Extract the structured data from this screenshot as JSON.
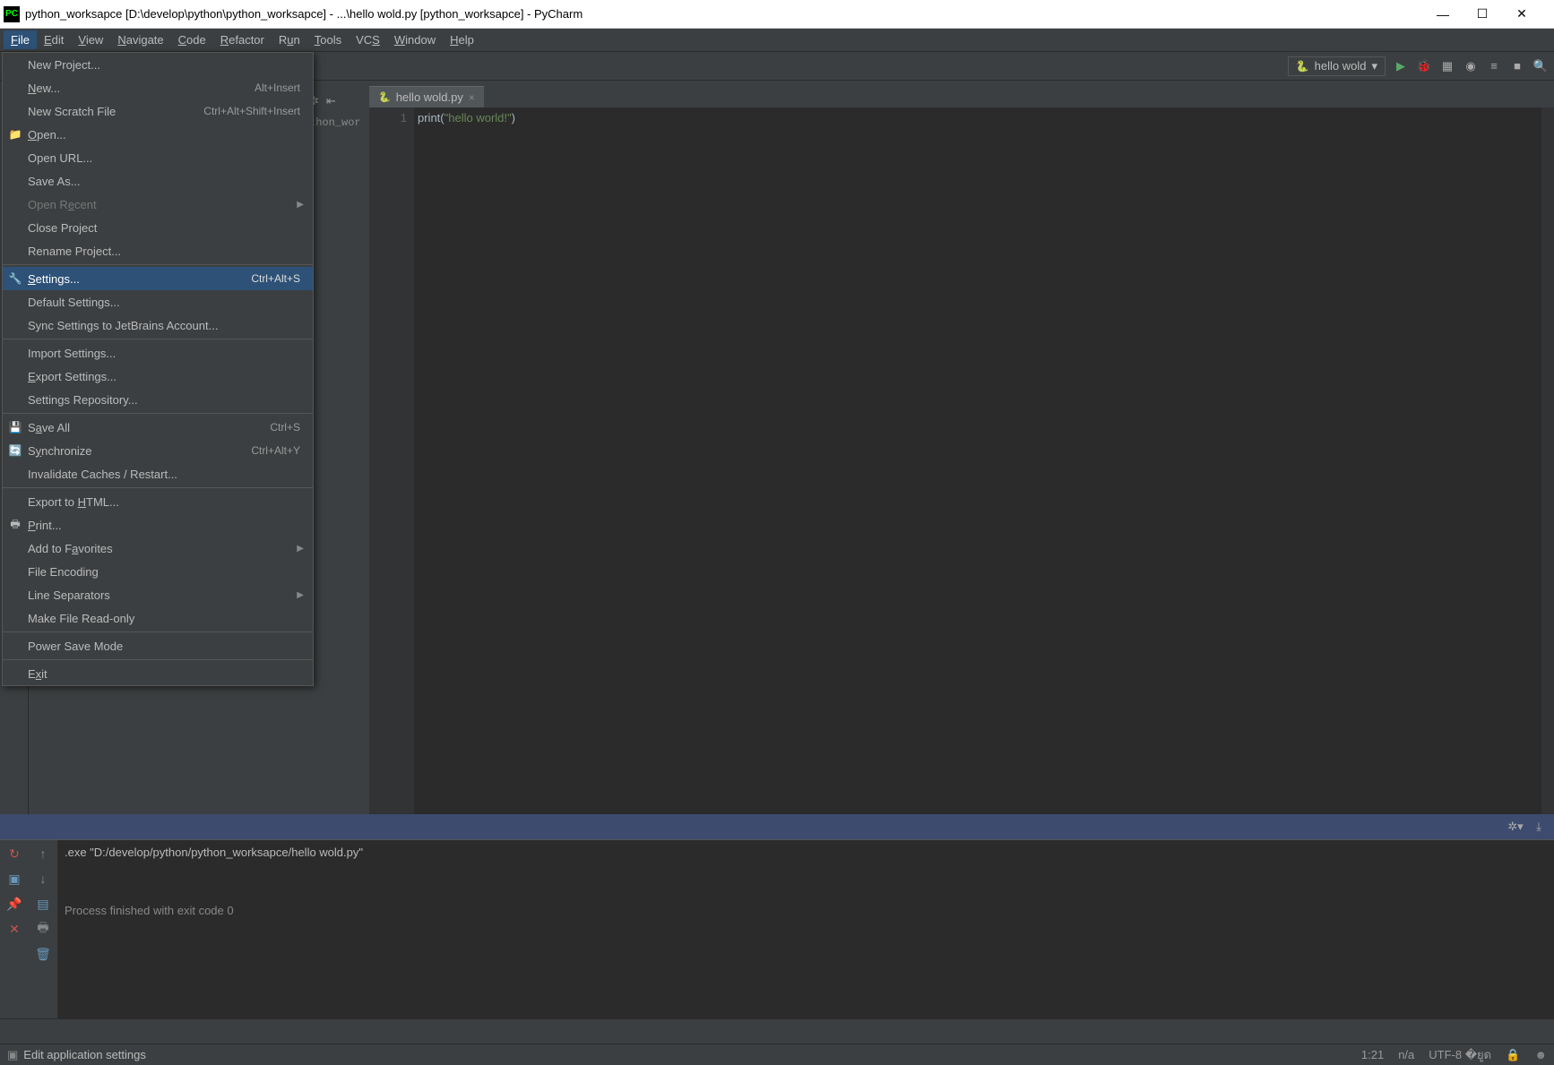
{
  "window": {
    "title": "python_worksapce [D:\\develop\\python\\python_worksapce] - ...\\hello wold.py [python_worksapce] - PyCharm",
    "minimize": "—",
    "maximize": "☐",
    "close": "✕"
  },
  "menubar": {
    "file": "File",
    "edit": "Edit",
    "view": "View",
    "navigate": "Navigate",
    "code": "Code",
    "refactor": "Refactor",
    "run": "Run",
    "tools": "Tools",
    "vcs": "VCS",
    "window": "Window",
    "help": "Help"
  },
  "file_menu": {
    "items": [
      {
        "label": "New Project...",
        "shortcut": "",
        "icon": "",
        "disabled": false
      },
      {
        "label_html": "<u>N</u>ew...",
        "shortcut": "Alt+Insert",
        "icon": "",
        "disabled": false
      },
      {
        "label": "New Scratch File",
        "shortcut": "Ctrl+Alt+Shift+Insert",
        "icon": "",
        "disabled": false
      },
      {
        "label_html": "<u>O</u>pen...",
        "shortcut": "",
        "icon": "folder",
        "disabled": false
      },
      {
        "label": "Open URL...",
        "shortcut": "",
        "icon": "",
        "disabled": false
      },
      {
        "label": "Save As...",
        "shortcut": "",
        "icon": "",
        "disabled": false
      },
      {
        "label_html": "Open R<u>e</u>cent",
        "shortcut": "",
        "icon": "",
        "disabled": true,
        "submenu": true
      },
      {
        "label": "Close Project",
        "shortcut": "",
        "icon": "",
        "disabled": false
      },
      {
        "label": "Rename Project...",
        "shortcut": "",
        "icon": "",
        "disabled": false
      },
      {
        "sep": true
      },
      {
        "label_html": "<u>S</u>ettings...",
        "shortcut": "Ctrl+Alt+S",
        "icon": "gear",
        "disabled": false,
        "selected": true
      },
      {
        "label": "Default Settings...",
        "shortcut": "",
        "icon": "",
        "disabled": false
      },
      {
        "label": "Sync Settings to JetBrains Account...",
        "shortcut": "",
        "icon": "",
        "disabled": false
      },
      {
        "sep": true
      },
      {
        "label": "Import Settings...",
        "shortcut": "",
        "icon": "",
        "disabled": false
      },
      {
        "label_html": "<u>E</u>xport Settings...",
        "shortcut": "",
        "icon": "",
        "disabled": false
      },
      {
        "label": "Settings Repository...",
        "shortcut": "",
        "icon": "",
        "disabled": false
      },
      {
        "sep": true
      },
      {
        "label_html": "S<u>a</u>ve All",
        "shortcut": "Ctrl+S",
        "icon": "save",
        "disabled": false
      },
      {
        "label_html": "S<u>y</u>nchronize",
        "shortcut": "Ctrl+Alt+Y",
        "icon": "sync",
        "disabled": false
      },
      {
        "label": "Invalidate Caches / Restart...",
        "shortcut": "",
        "icon": "",
        "disabled": false
      },
      {
        "sep": true
      },
      {
        "label_html": "Export to <u>H</u>TML...",
        "shortcut": "",
        "icon": "",
        "disabled": false
      },
      {
        "label_html": "<u>P</u>rint...",
        "shortcut": "",
        "icon": "print",
        "disabled": false
      },
      {
        "label_html": "Add to F<u>a</u>vorites",
        "shortcut": "",
        "icon": "",
        "disabled": false,
        "submenu": true
      },
      {
        "label": "File Encoding",
        "shortcut": "",
        "icon": "",
        "disabled": false
      },
      {
        "label": "Line Separators",
        "shortcut": "",
        "icon": "",
        "disabled": false,
        "submenu": true
      },
      {
        "label": "Make File Read-only",
        "shortcut": "",
        "icon": "",
        "disabled": false
      },
      {
        "sep": true
      },
      {
        "label": "Power Save Mode",
        "shortcut": "",
        "icon": "",
        "disabled": false
      },
      {
        "sep": true
      },
      {
        "label_html": "E<u>x</u>it",
        "shortcut": "",
        "icon": "",
        "disabled": false
      }
    ]
  },
  "toolbar": {
    "run_config": "hello wold",
    "dropdown_arrow": "▾"
  },
  "editor": {
    "tab_name": "hello wold.py",
    "line_number": "1",
    "code_fn": "print",
    "code_paren_open": "(",
    "code_str": "\"hello world!\"",
    "code_paren_close": ")"
  },
  "proj_peek": "thon_wor",
  "run_panel": {
    "output_line1": ".exe \"D:/develop/python/python_worksapce/hello wold.py\"",
    "output_exit": "Process finished with exit code 0"
  },
  "status": {
    "hint": "Edit application settings",
    "position": "1:21",
    "na": "n/a",
    "encoding": "UTF-8",
    "lock": "🔒"
  }
}
